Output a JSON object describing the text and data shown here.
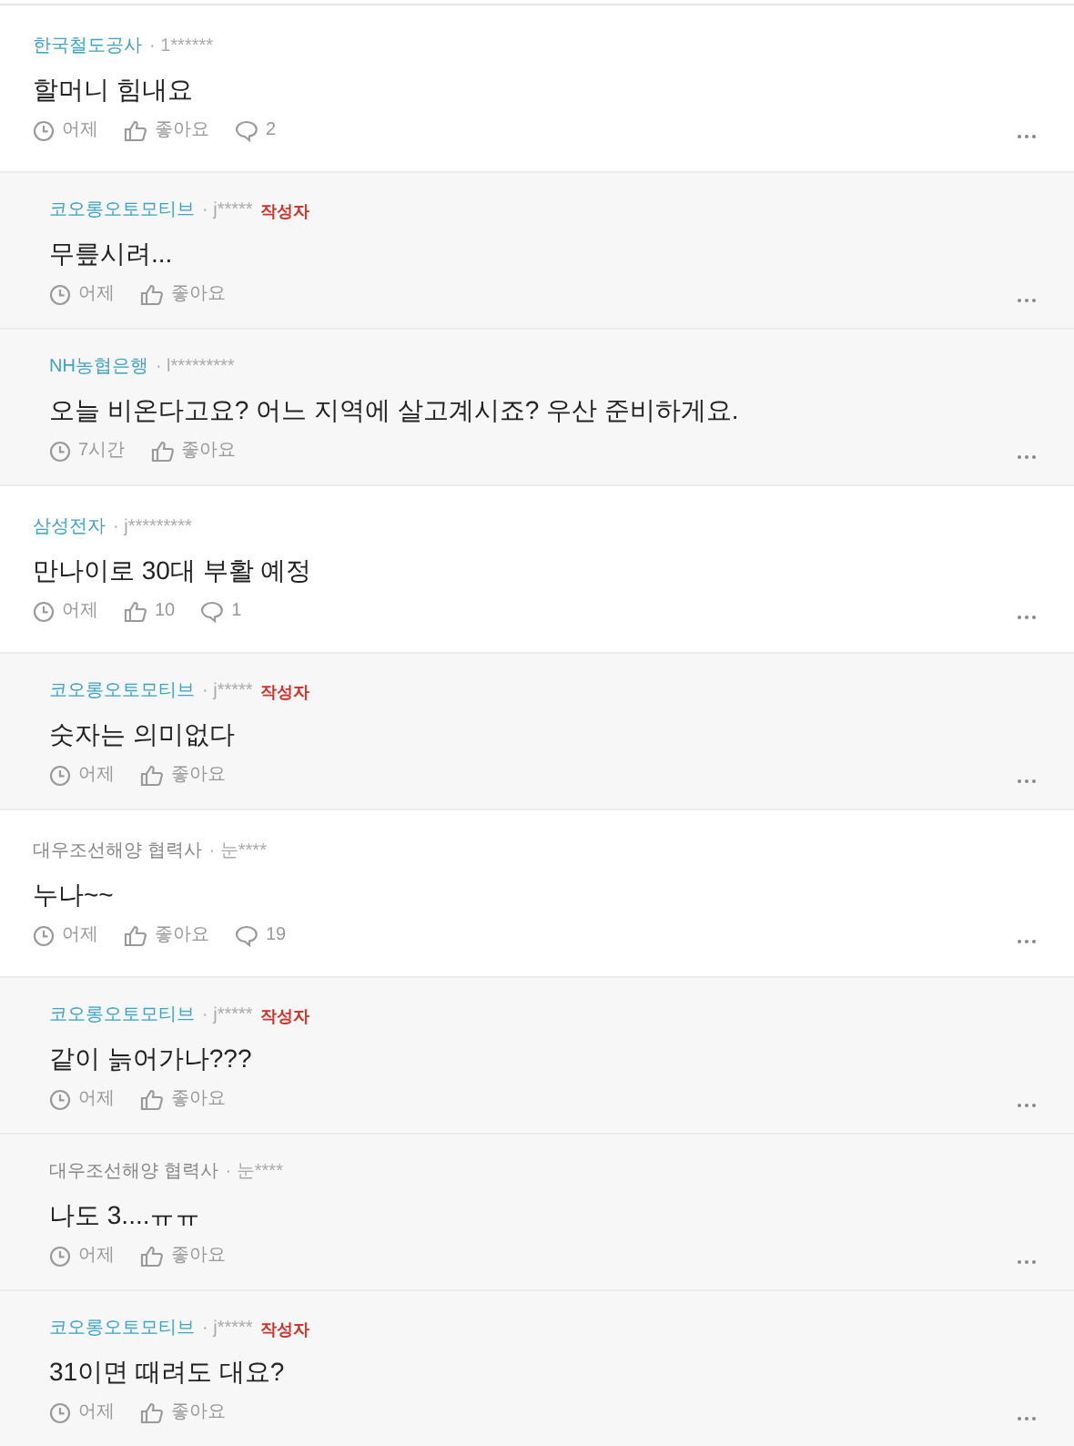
{
  "comments": [
    {
      "kind": "comment",
      "company": "한국철도공사",
      "verified": true,
      "user": "· 1******",
      "body": "할머니 힘내요",
      "time": "어제",
      "likes": "좋아요",
      "replies": "2"
    },
    {
      "kind": "reply",
      "company": "코오롱오토모티브",
      "verified": true,
      "user": "· j*****",
      "badge": "작성자",
      "body": "무릎시려...",
      "time": "어제",
      "likes": "좋아요"
    },
    {
      "kind": "reply",
      "company": "NH농협은행",
      "verified": true,
      "user": "· l*********",
      "body": "오늘 비온다고요? 어느 지역에 살고계시죠? 우산 준비하게요.",
      "time": "7시간",
      "likes": "좋아요"
    },
    {
      "kind": "comment",
      "company": "삼성전자",
      "verified": true,
      "user": "· j*********",
      "body": "만나이로 30대 부활 예정",
      "time": "어제",
      "likes": "10",
      "replies": "1"
    },
    {
      "kind": "reply",
      "company": "코오롱오토모티브",
      "verified": true,
      "user": "· j*****",
      "badge": "작성자",
      "body": "숫자는 의미없다",
      "time": "어제",
      "likes": "좋아요"
    },
    {
      "kind": "comment",
      "company": "대우조선해양 협력사",
      "verified": false,
      "user": "· 눈****",
      "body": "누나~~",
      "time": "어제",
      "likes": "좋아요",
      "replies": "19"
    },
    {
      "kind": "reply",
      "company": "코오롱오토모티브",
      "verified": true,
      "user": "· j*****",
      "badge": "작성자",
      "body": "같이 늙어가나???",
      "time": "어제",
      "likes": "좋아요"
    },
    {
      "kind": "reply",
      "company": "대우조선해양 협력사",
      "verified": false,
      "user": "· 눈****",
      "body": "나도 3....ㅠㅠ",
      "time": "어제",
      "likes": "좋아요"
    },
    {
      "kind": "reply",
      "company": "코오롱오토모티브",
      "verified": true,
      "user": "· j*****",
      "badge": "작성자",
      "body": "31이면 때려도 대요?",
      "time": "어제",
      "likes": "좋아요"
    }
  ]
}
